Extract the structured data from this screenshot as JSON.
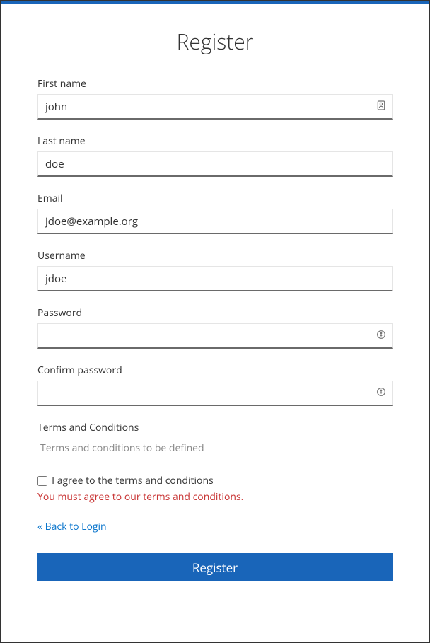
{
  "page": {
    "title": "Register"
  },
  "form": {
    "firstName": {
      "label": "First name",
      "value": "john"
    },
    "lastName": {
      "label": "Last name",
      "value": "doe"
    },
    "email": {
      "label": "Email",
      "value": "jdoe@example.org"
    },
    "username": {
      "label": "Username",
      "value": "jdoe"
    },
    "password": {
      "label": "Password",
      "value": ""
    },
    "confirm": {
      "label": "Confirm password",
      "value": ""
    }
  },
  "terms": {
    "label": "Terms and Conditions",
    "text": "Terms and conditions to be defined",
    "agreeLabel": "I agree to the terms and conditions",
    "error": "You must agree to our terms and conditions."
  },
  "nav": {
    "backToLogin": "« Back to Login"
  },
  "actions": {
    "submit": "Register"
  }
}
